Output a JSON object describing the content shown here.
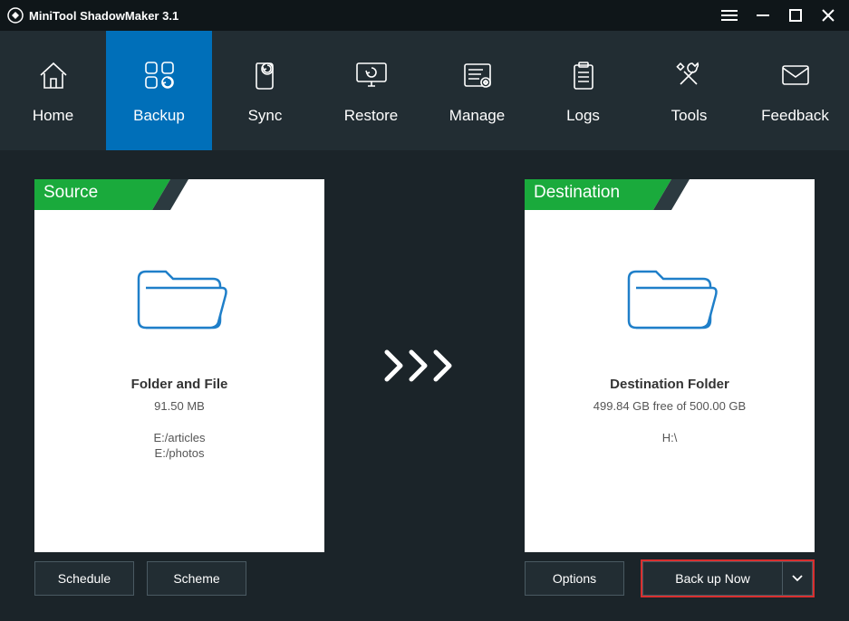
{
  "app": {
    "title": "MiniTool ShadowMaker 3.1"
  },
  "toolbar": {
    "items": [
      {
        "label": "Home"
      },
      {
        "label": "Backup"
      },
      {
        "label": "Sync"
      },
      {
        "label": "Restore"
      },
      {
        "label": "Manage"
      },
      {
        "label": "Logs"
      },
      {
        "label": "Tools"
      },
      {
        "label": "Feedback"
      }
    ]
  },
  "source": {
    "header": "Source",
    "type_title": "Folder and File",
    "size": "91.50 MB",
    "path1": "E:/articles",
    "path2": "E:/photos"
  },
  "destination": {
    "header": "Destination",
    "type_title": "Destination Folder",
    "free": "499.84 GB free of 500.00 GB",
    "path": "H:\\"
  },
  "buttons": {
    "schedule": "Schedule",
    "scheme": "Scheme",
    "options": "Options",
    "backup_now": "Back up Now"
  }
}
